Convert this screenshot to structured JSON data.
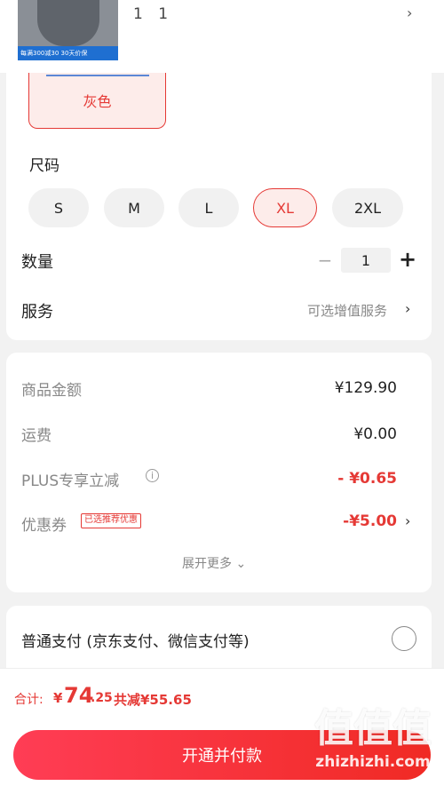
{
  "product": {
    "name": "1 1",
    "thumb_banner": "每满300减30  30天价保"
  },
  "spec": {
    "color_selected": "灰色",
    "size_title": "尺码",
    "sizes": [
      {
        "label": "S",
        "selected": false
      },
      {
        "label": "M",
        "selected": false
      },
      {
        "label": "L",
        "selected": false
      },
      {
        "label": "XL",
        "selected": true
      },
      {
        "label": "2XL",
        "selected": false
      }
    ],
    "quantity_label": "数量",
    "quantity_minus": "−",
    "quantity_value": "1",
    "quantity_plus": "+",
    "service_label": "服务",
    "service_value": "可选增值服务"
  },
  "price": {
    "goods_label": "商品金额",
    "goods_value": "¥129.90",
    "shipping_label": "运费",
    "shipping_value": "¥0.00",
    "plus_label": "PLUS专享立减",
    "plus_value": "- ¥0.65",
    "coupon_label": "优惠券",
    "coupon_tag": "已选推荐优惠",
    "coupon_value": "-¥5.00",
    "expand_label": "展开更多"
  },
  "payment": {
    "method_label": "普通支付 (京东支付、微信支付等)"
  },
  "footer": {
    "total_label": "合计:",
    "currency": "¥",
    "total_int": "74",
    "total_dec": ".25",
    "saved_text": "共减¥55.65",
    "pay_button": "开通并付款"
  },
  "watermark": {
    "glyphs": "值值值",
    "site": "zhizhizhi.com"
  },
  "colors": {
    "accent": "#e53935",
    "button_start": "#ff3d55",
    "button_end": "#f02a24",
    "background": "#f2f2f2"
  },
  "icons": {
    "chevron": "›",
    "info": "i",
    "expand": "⌄"
  }
}
